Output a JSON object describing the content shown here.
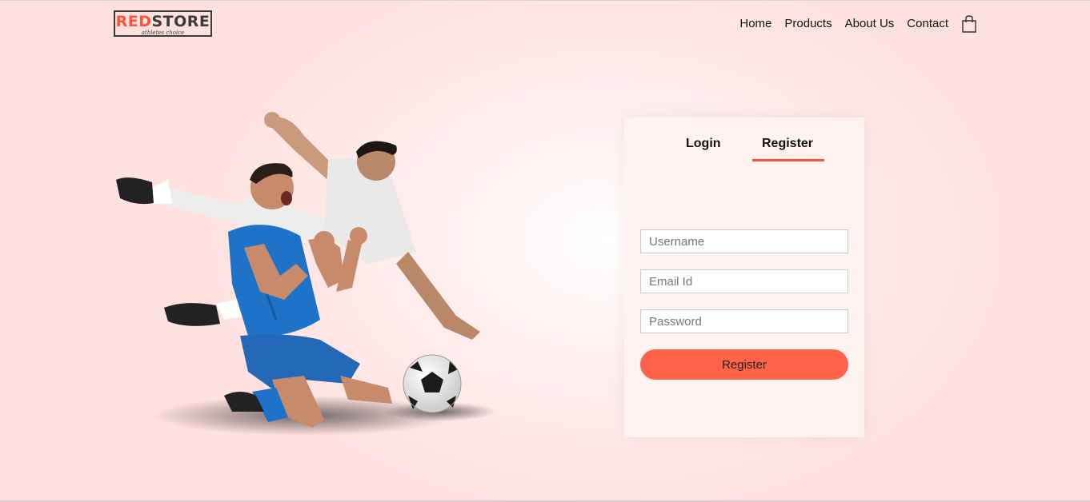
{
  "brand": {
    "name_red": "RED",
    "name_dark": "STORE",
    "tagline": "athletes choice"
  },
  "nav": {
    "items": [
      {
        "label": "Home"
      },
      {
        "label": "Products"
      },
      {
        "label": "About Us"
      },
      {
        "label": "Contact"
      }
    ],
    "cart_icon": "shopping-bag-icon"
  },
  "hero": {
    "image": "soccer-players-illustration"
  },
  "form": {
    "tabs": {
      "login": "Login",
      "register": "Register",
      "active": "Register"
    },
    "fields": {
      "username": {
        "placeholder": "Username",
        "value": ""
      },
      "email": {
        "placeholder": "Email Id",
        "value": ""
      },
      "password": {
        "placeholder": "Password",
        "value": ""
      }
    },
    "submit_label": "Register"
  },
  "colors": {
    "accent": "#ff523b",
    "button": "#ff6248",
    "background": "#ffe1df"
  }
}
